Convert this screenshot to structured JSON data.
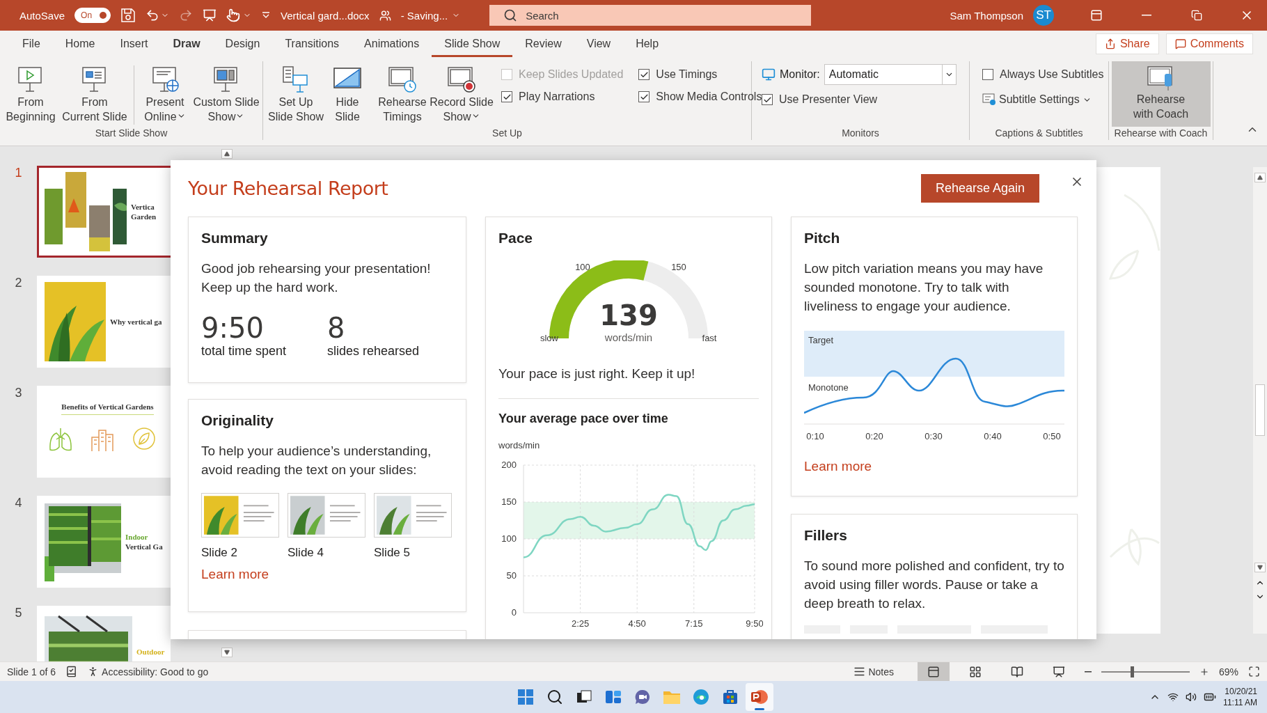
{
  "title_bar": {
    "autosave_label": "AutoSave",
    "autosave": {
      "label": "On",
      "on": true
    },
    "file_name": "Vertical gard...docx",
    "save_status": "- Saving...",
    "search": {
      "placeholder": "Search"
    },
    "user_name": "Sam Thompson",
    "user_initials": "ST"
  },
  "ribbon_tabs": [
    {
      "label": "File",
      "selected": false,
      "hovered": false
    },
    {
      "label": "Home",
      "selected": false,
      "hovered": false
    },
    {
      "label": "Insert",
      "selected": false,
      "hovered": false
    },
    {
      "label": "Draw",
      "selected": false,
      "hovered": true
    },
    {
      "label": "Design",
      "selected": false,
      "hovered": false
    },
    {
      "label": "Transitions",
      "selected": false,
      "hovered": false
    },
    {
      "label": "Animations",
      "selected": false,
      "hovered": false
    },
    {
      "label": "Slide Show",
      "selected": true,
      "hovered": false
    },
    {
      "label": "Review",
      "selected": false,
      "hovered": false
    },
    {
      "label": "View",
      "selected": false,
      "hovered": false
    },
    {
      "label": "Help",
      "selected": false,
      "hovered": false
    }
  ],
  "share_button": "Share",
  "comments_button": "Comments",
  "ribbon": {
    "start_slide_show": {
      "label": "Start Slide Show",
      "buttons": [
        {
          "lines": [
            "From",
            "Beginning"
          ],
          "dropdown": false
        },
        {
          "lines": [
            "From",
            "Current Slide"
          ],
          "dropdown": false
        },
        {
          "lines": [
            "Present",
            "Online"
          ],
          "dropdown": true
        },
        {
          "lines": [
            "Custom Slide",
            "Show"
          ],
          "dropdown": true
        }
      ]
    },
    "set_up": {
      "label": "Set Up",
      "buttons": [
        {
          "lines": [
            "Set Up",
            "Slide Show"
          ],
          "dropdown": false
        },
        {
          "lines": [
            "Hide",
            "Slide"
          ],
          "dropdown": false
        },
        {
          "lines": [
            "Rehearse",
            "Timings"
          ],
          "dropdown": false
        },
        {
          "lines": [
            "Record Slide",
            "Show"
          ],
          "dropdown": true
        }
      ],
      "checkboxes": [
        {
          "label": "Keep Slides Updated",
          "checked": false,
          "disabled": true
        },
        {
          "label": "Use Timings",
          "checked": true,
          "disabled": false
        },
        {
          "label": "Play Narrations",
          "checked": true,
          "disabled": false
        },
        {
          "label": "Show Media Controls",
          "checked": true,
          "disabled": false
        }
      ]
    },
    "monitors": {
      "label": "Monitors",
      "monitor_label": "Monitor:",
      "monitor_value": "Automatic",
      "presenter_view": {
        "label": "Use Presenter View",
        "checked": true
      }
    },
    "captions": {
      "label": "Captions & Subtitles",
      "always_subtitles": {
        "label": "Always Use Subtitles",
        "checked": false
      },
      "subtitle_settings": "Subtitle Settings"
    },
    "coach": {
      "label": "Rehearse with Coach",
      "button": {
        "lines": [
          "Rehearse",
          "with Coach"
        ],
        "pressed": true
      }
    }
  },
  "slides": [
    {
      "number": "1",
      "selected": true,
      "title_lines": [
        "Vertica",
        "Garden"
      ]
    },
    {
      "number": "2",
      "selected": false,
      "title_lines": [
        "Why vertical ga"
      ]
    },
    {
      "number": "3",
      "selected": false,
      "title_lines": [
        "Benefits of Vertical Gardens"
      ]
    },
    {
      "number": "4",
      "selected": false,
      "title_lines": [
        "Indoor",
        "Vertical Ga"
      ]
    },
    {
      "number": "5",
      "selected": false,
      "title_lines": [
        "Outdoor"
      ]
    }
  ],
  "report": {
    "title": "Your Rehearsal Report",
    "rehearse_again": "Rehearse Again",
    "summary": {
      "title": "Summary",
      "message": "Good job rehearsing your presentation! Keep up the hard work.",
      "stats": [
        {
          "value": "9:50",
          "label": "total time spent"
        },
        {
          "value": "8",
          "label": "slides rehearsed"
        }
      ]
    },
    "originality": {
      "title": "Originality",
      "message": "To help your audience’s understanding, avoid reading the text on your slides:",
      "slides": [
        {
          "label": "Slide 2"
        },
        {
          "label": "Slide 4"
        },
        {
          "label": "Slide 5"
        }
      ],
      "link": "Learn more"
    },
    "pace": {
      "title": "Pace",
      "gauge": {
        "level": 0.58,
        "value": "139",
        "unit": "words/min",
        "low_label": "100",
        "high_label": "150",
        "min_label": "slow",
        "max_label": "fast"
      },
      "message": "Your pace is just right. Keep it up!",
      "over_time_title": "Your average pace over time",
      "chart_data": {
        "type": "line",
        "ylabel": "words/min",
        "x": [
          0,
          60,
          120,
          145,
          180,
          210,
          260,
          290,
          330,
          370,
          390,
          420,
          450,
          465,
          480,
          510,
          540,
          570,
          590
        ],
        "series": [
          {
            "color": "#7fd6c2",
            "values": [
              75,
              105,
              127,
              130,
              118,
              110,
              115,
              120,
              140,
              160,
              158,
              120,
              90,
              85,
              97,
              125,
              140,
              145,
              147
            ]
          }
        ],
        "xlim": [
          0,
          590
        ],
        "ylim": [
          0,
          200
        ],
        "xticks": [
          {
            "value": 145,
            "label": "2:25"
          },
          {
            "value": 290,
            "label": "4:50"
          },
          {
            "value": 435,
            "label": "7:15"
          },
          {
            "value": 590,
            "label": "9:50"
          }
        ],
        "yticks": [
          0,
          50,
          100,
          150,
          200
        ],
        "grid": true,
        "bands": [
          {
            "axis": "y",
            "from": 100,
            "to": 150
          }
        ]
      }
    },
    "pitch": {
      "title": "Pitch",
      "message": "Low pitch variation means you may have sounded monotone. Try to talk with liveliness to engage your audience.",
      "chart": {
        "band_labels": [
          "Target",
          "Monotone"
        ],
        "x_labels": [
          "0:10",
          "0:20",
          "0:30",
          "0:40",
          "0:50"
        ]
      },
      "link": "Learn more"
    },
    "fillers": {
      "title": "Fillers",
      "message": "To sound more polished and confident, try to avoid using filler words. Pause or take a deep breath to relax."
    }
  },
  "status_bar": {
    "slide_position": "Slide 1 of 6",
    "accessibility": "Accessibility: Good to go",
    "notes": "Notes",
    "views": [
      {
        "selected": true
      },
      {
        "selected": false
      },
      {
        "selected": false
      },
      {
        "selected": false
      }
    ],
    "zoom": {
      "level": 0.35,
      "reading": "69%"
    }
  },
  "taskbar": {
    "apps": [
      {
        "selected": false
      },
      {
        "selected": false
      },
      {
        "selected": false
      },
      {
        "selected": false
      },
      {
        "selected": false
      },
      {
        "selected": false
      },
      {
        "selected": false
      },
      {
        "selected": false
      },
      {
        "selected": true
      }
    ],
    "date": "10/20/21",
    "time": "11:11 AM"
  }
}
